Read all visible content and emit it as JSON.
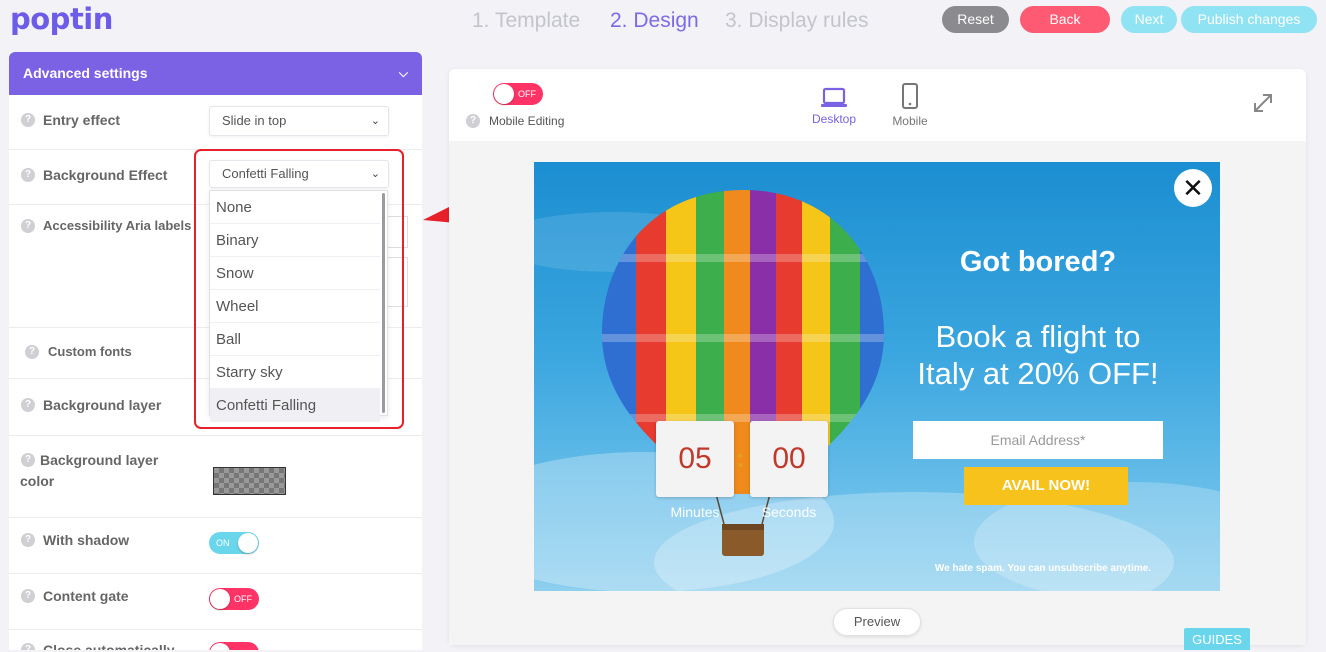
{
  "brand": {
    "logo": "poptin"
  },
  "steps": [
    {
      "label": "1. Template",
      "active": false
    },
    {
      "label": "2. Design",
      "active": true
    },
    {
      "label": "3. Display rules",
      "active": false
    }
  ],
  "actions": {
    "reset": "Reset",
    "back": "Back",
    "next": "Next",
    "publish": "Publish changes"
  },
  "colors": {
    "accent": "#7b61e4",
    "reset": "#8a8a8f",
    "back": "#ff5a73",
    "next": "#8fe3f2",
    "toggle_on": "#6ad6ec",
    "toggle_off": "#ff3366",
    "popup_cta": "#f7c21b",
    "highlight": "#e8202a"
  },
  "panel": {
    "title": "Advanced settings",
    "settings": {
      "entry_effect": {
        "label": "Entry effect",
        "value": "Slide in top"
      },
      "background_effect": {
        "label": "Background Effect",
        "value": "Confetti Falling",
        "options": [
          "None",
          "Binary",
          "Snow",
          "Wheel",
          "Ball",
          "Starry sky",
          "Confetti Falling"
        ]
      },
      "aria": {
        "label": "Accessibility Aria labels"
      },
      "custom_fonts": {
        "label": "Custom fonts"
      },
      "background_layer": {
        "label": "Background layer"
      },
      "background_layer_color": {
        "label_line1": "Background layer",
        "label_line2": "color"
      },
      "with_shadow": {
        "label": "With shadow",
        "toggle": "ON"
      },
      "content_gate": {
        "label": "Content gate",
        "toggle": "OFF"
      },
      "close_auto": {
        "label": "Close automatically"
      }
    }
  },
  "preview": {
    "mobile_editing": {
      "label": "Mobile Editing",
      "toggle": "OFF"
    },
    "devices": {
      "desktop": "Desktop",
      "mobile": "Mobile"
    },
    "preview_button": "Preview",
    "guides": "GUIDES"
  },
  "popup": {
    "close": "✕",
    "countdown": {
      "minutes_value": "05",
      "seconds_value": "00",
      "minutes_label": "Minutes",
      "seconds_label": "Seconds",
      "separator": ":"
    },
    "heading": "Got bored?",
    "subheading": "Book a flight to Italy at 20% OFF!",
    "email_placeholder": "Email Address*",
    "cta": "AVAIL NOW!",
    "footer": "We hate spam. You can unsubscribe anytime."
  }
}
